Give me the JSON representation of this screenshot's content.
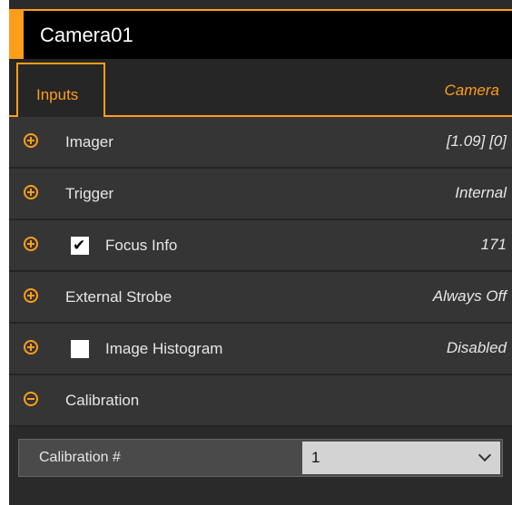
{
  "panel": {
    "title": "Camera01",
    "accent_color": "#ff9d1b"
  },
  "tabs": {
    "active": "Inputs",
    "right_label": "Camera"
  },
  "rows": [
    {
      "label": "Imager",
      "value": "[1.09]  [0]",
      "expanded": false
    },
    {
      "label": "Trigger",
      "value": "Internal",
      "expanded": false
    },
    {
      "label": "Focus Info",
      "value": "171",
      "checkbox": true,
      "checked": true,
      "expanded": false
    },
    {
      "label": "External Strobe",
      "value": "Always Off",
      "expanded": false
    },
    {
      "label": "Image Histogram",
      "value": "Disabled",
      "checkbox": true,
      "checked": false,
      "expanded": false
    },
    {
      "label": "Calibration",
      "value": "",
      "expanded": true
    }
  ],
  "calibration": {
    "field_label": "Calibration #",
    "selected": "1"
  },
  "icons": {
    "expand": "plus-circle-icon",
    "collapse": "minus-circle-icon",
    "checkmark": "✔"
  }
}
